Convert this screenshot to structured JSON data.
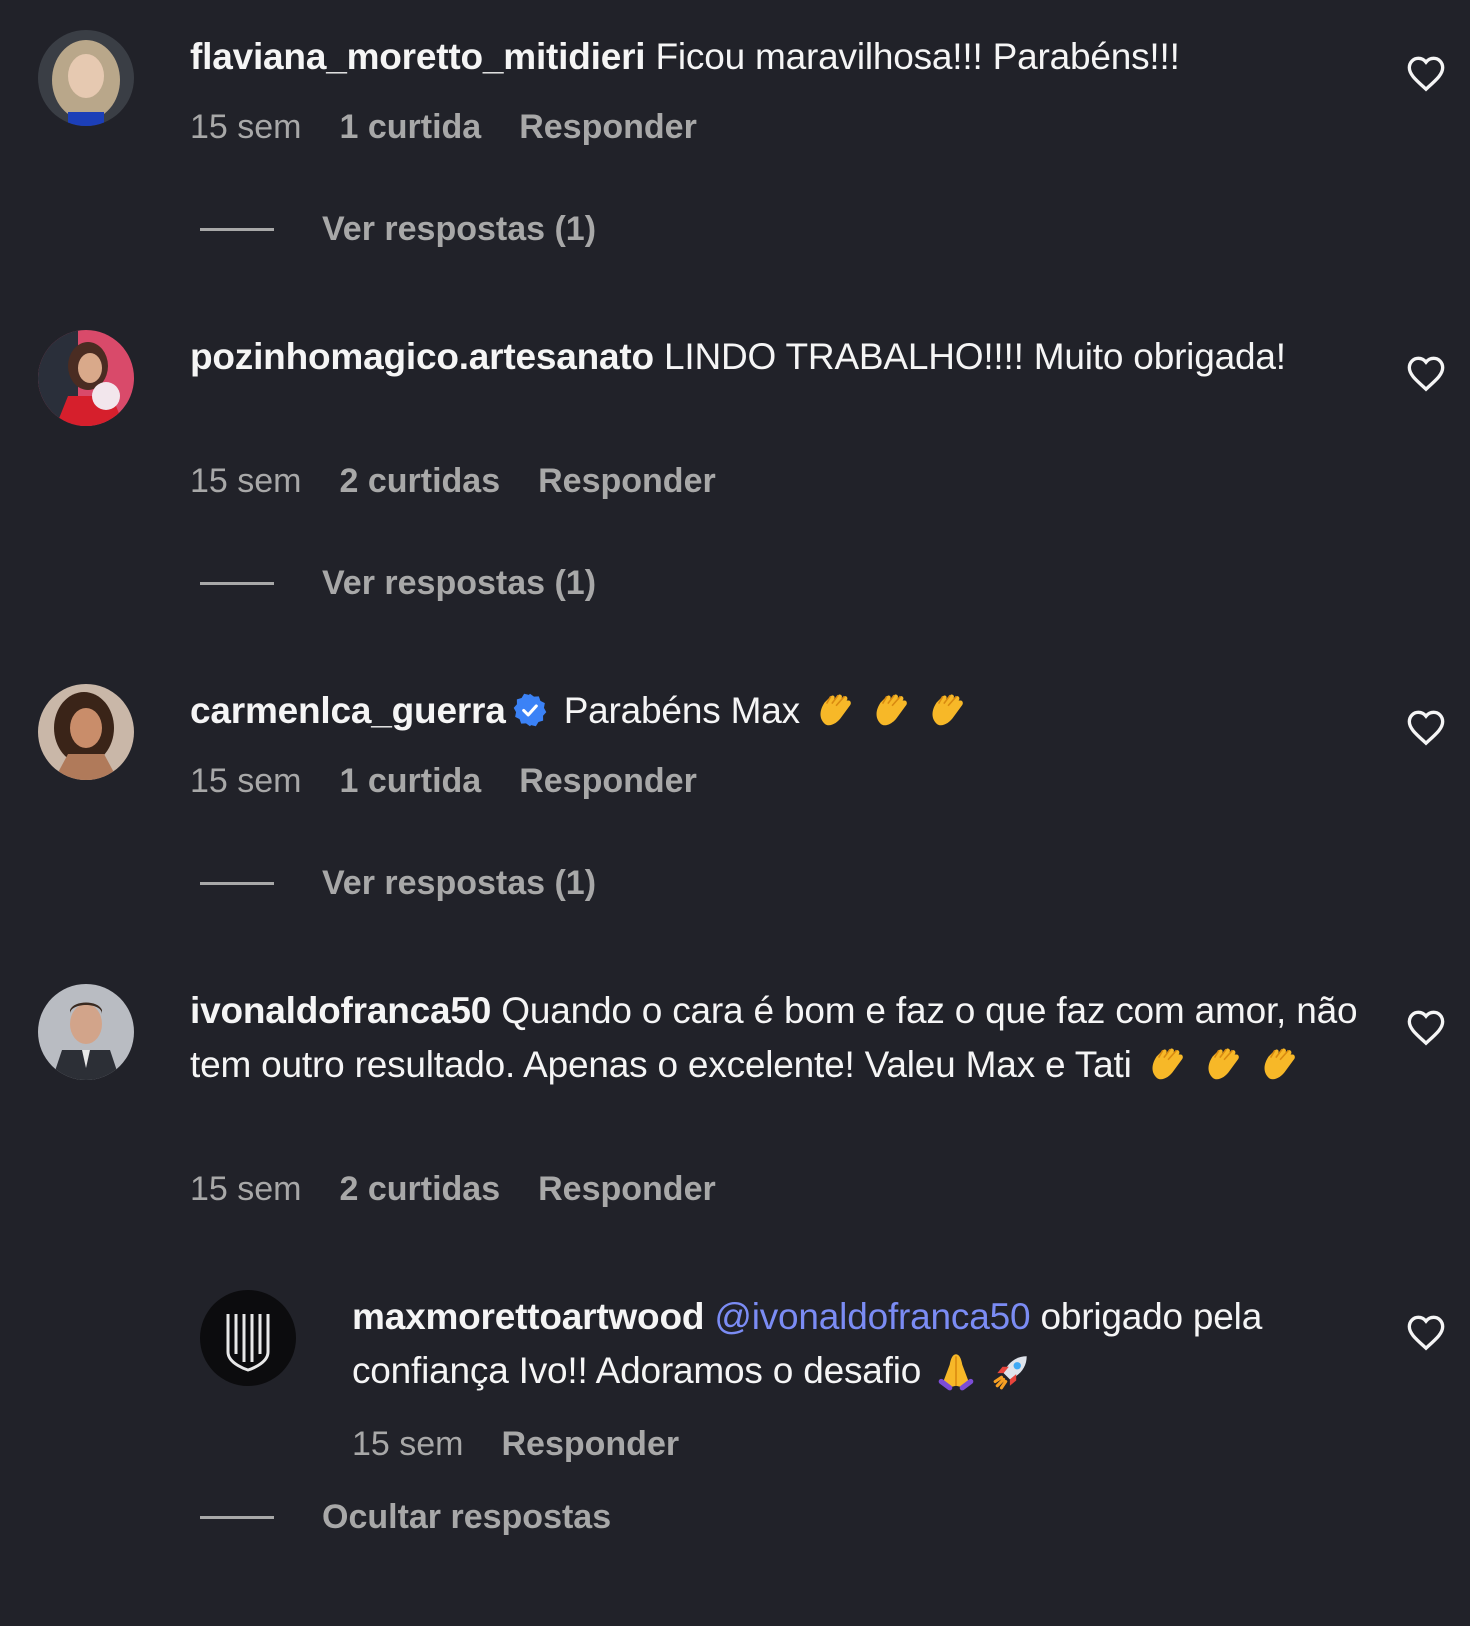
{
  "comments": [
    {
      "username": "flaviana_moretto_mitidieri",
      "text": "Ficou maravilhosa!!! Parabéns!!!",
      "time": "15 sem",
      "likes": "1 curtida",
      "reply_label": "Responder",
      "view_replies": "Ver respostas (1)"
    },
    {
      "username": "pozinhomagico.artesanato",
      "text": "LINDO TRABALHO!!!! Muito obrigada!",
      "time": "15 sem",
      "likes": "2 curtidas",
      "reply_label": "Responder",
      "view_replies": "Ver respostas (1)"
    },
    {
      "username": "carmenlca_guerra",
      "verified": true,
      "text": "Parabéns Max",
      "emojis": [
        "clapping-hands",
        "clapping-hands",
        "clapping-hands"
      ],
      "time": "15 sem",
      "likes": "1 curtida",
      "reply_label": "Responder",
      "view_replies": "Ver respostas (1)"
    },
    {
      "username": "ivonaldofranca50",
      "text": "Quando o cara é bom e faz o que faz com amor, não tem outro resultado. Apenas o excelente! Valeu Max e Tati",
      "emojis": [
        "clapping-hands",
        "clapping-hands",
        "clapping-hands"
      ],
      "time": "15 sem",
      "likes": "2 curtidas",
      "reply_label": "Responder",
      "replies": [
        {
          "username": "maxmorettoartwood",
          "mention": "@ivonaldofranca50",
          "text": "obrigado pela confiança Ivo!! Adoramos o desafio",
          "emojis": [
            "folded-hands",
            "rocket"
          ],
          "time": "15 sem",
          "reply_label": "Responder"
        }
      ],
      "hide_replies": "Ocultar respostas"
    }
  ],
  "colors": {
    "background": "#212229",
    "text": "#f5f5f5",
    "muted": "#a8a8a8",
    "mention": "#7b8cf4",
    "verified": "#3b82f6"
  }
}
